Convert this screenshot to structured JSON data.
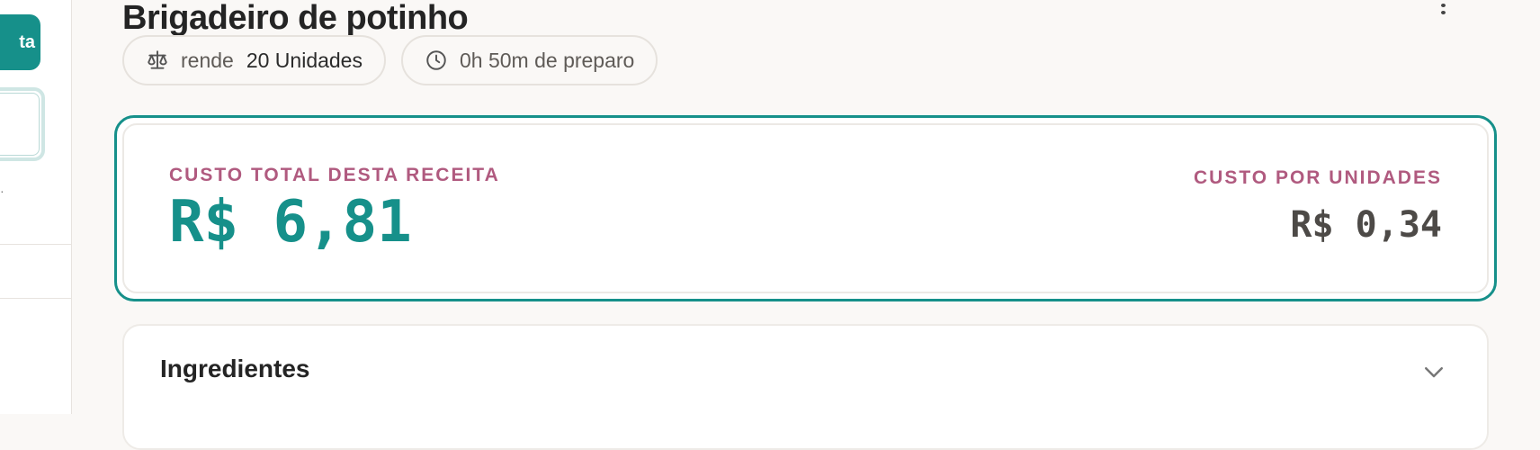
{
  "sidebar": {
    "cta_label": "ta"
  },
  "header": {
    "title": "Brigadeiro de potinho"
  },
  "chips": {
    "yield_prefix": "rende",
    "yield_value": "20 Unidades",
    "time": "0h 50m de preparo"
  },
  "cost": {
    "total_label": "CUSTO TOTAL DESTA RECEITA",
    "total_value": "R$ 6,81",
    "unit_label": "CUSTO POR UNIDADES",
    "unit_value": "R$ 0,34"
  },
  "ingredients": {
    "title": "Ingredientes"
  },
  "colors": {
    "accent": "#16908a",
    "label": "#b05a7f",
    "background": "#faf8f6"
  },
  "icons": {
    "yield": "scale-icon",
    "time": "clock-icon",
    "expand": "chevron-down-icon",
    "menu": "more-vertical-icon"
  }
}
